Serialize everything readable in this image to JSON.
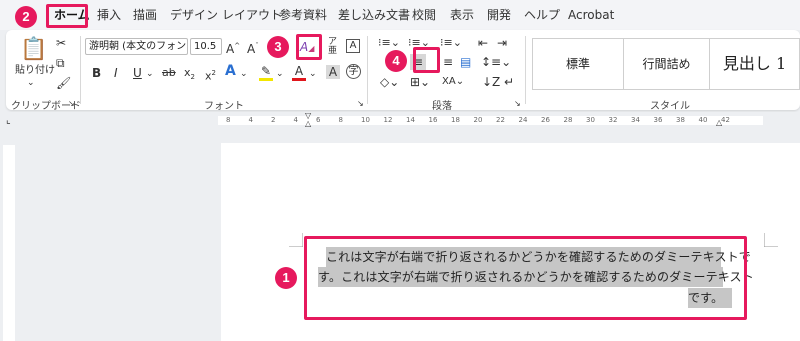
{
  "tabs": [
    "ホーム",
    "挿入",
    "描画",
    "デザイン",
    "レイアウト",
    "参考資料",
    "差し込み文書",
    "校閲",
    "表示",
    "開発",
    "ヘルプ",
    "Acrobat"
  ],
  "badges": [
    "1",
    "2",
    "3",
    "4"
  ],
  "clipboard": {
    "paste": "貼り付け",
    "group": "クリップボード"
  },
  "font": {
    "name": "游明朝 (本文のフォント",
    "size": "10.5",
    "group": "フォント"
  },
  "paragraph": {
    "group": "段落"
  },
  "styles": {
    "items": [
      "標準",
      "行間詰め",
      "見出し 1"
    ],
    "group": "スタイル"
  },
  "ruler": {
    "marks": [
      "8",
      "4",
      "2",
      "4",
      "6",
      "8",
      "10",
      "12",
      "14",
      "16",
      "18",
      "20",
      "22",
      "24",
      "26",
      "28",
      "30",
      "32",
      "34",
      "36",
      "38",
      "40",
      "42"
    ]
  },
  "document": {
    "lines": [
      "これは文字が右端で折り返されるかどうかを確認するためのダミーテキストで",
      "す。これは文字が右端で折り返されるかどうかを確認するためのダミーテキスト",
      "です。"
    ]
  },
  "colors": {
    "accent": "#e6195d",
    "selection": "#c6c6c6"
  }
}
